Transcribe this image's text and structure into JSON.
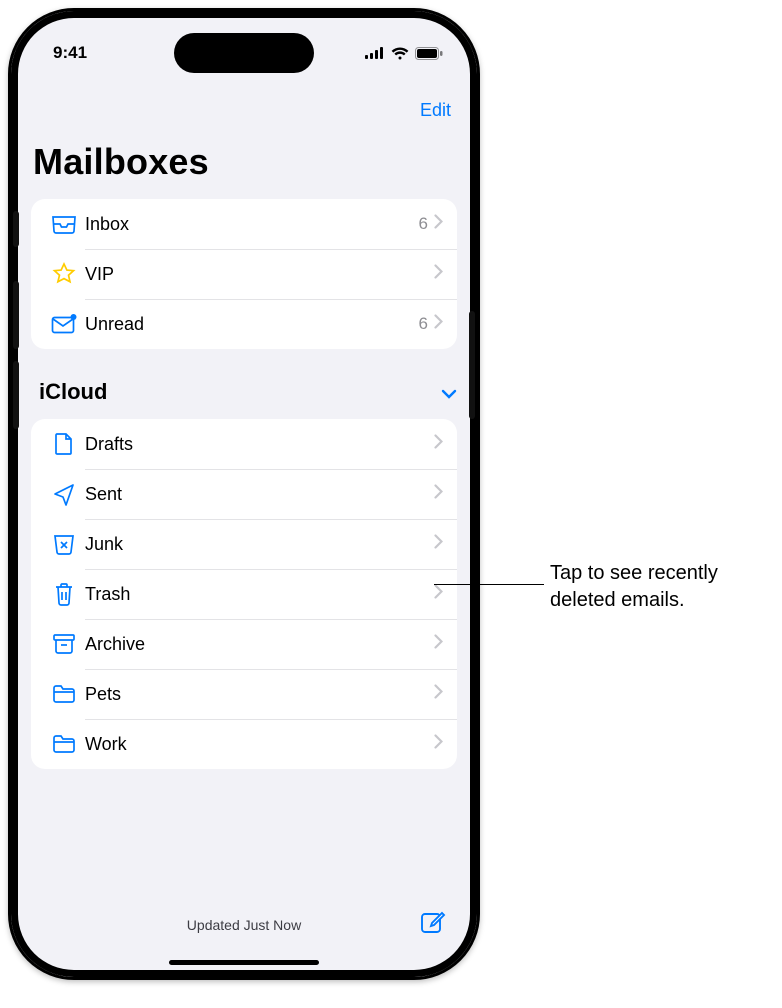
{
  "status": {
    "time": "9:41"
  },
  "nav": {
    "edit": "Edit"
  },
  "title": "Mailboxes",
  "primary": [
    {
      "label": "Inbox",
      "count": "6",
      "icon": "inbox-icon"
    },
    {
      "label": "VIP",
      "count": "",
      "icon": "vip-star-icon"
    },
    {
      "label": "Unread",
      "count": "6",
      "icon": "unread-envelope-icon"
    }
  ],
  "section": {
    "title": "iCloud"
  },
  "icloud": [
    {
      "label": "Drafts",
      "icon": "drafts-icon"
    },
    {
      "label": "Sent",
      "icon": "sent-icon"
    },
    {
      "label": "Junk",
      "icon": "junk-icon"
    },
    {
      "label": "Trash",
      "icon": "trash-icon"
    },
    {
      "label": "Archive",
      "icon": "archive-icon"
    },
    {
      "label": "Pets",
      "icon": "folder-icon"
    },
    {
      "label": "Work",
      "icon": "folder-icon"
    }
  ],
  "toolbar": {
    "status": "Updated Just Now"
  },
  "callout": {
    "text": "Tap to see recently deleted emails."
  }
}
